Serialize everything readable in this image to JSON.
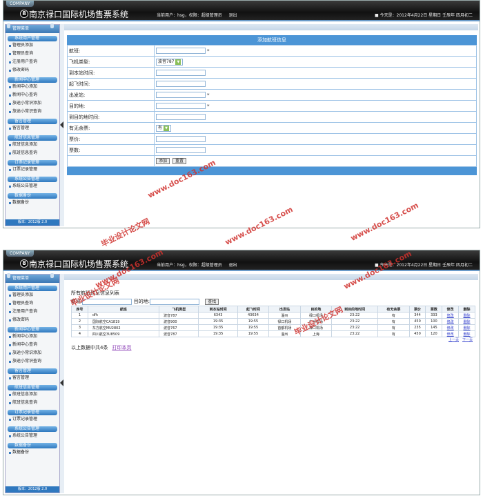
{
  "header": {
    "company": "COMPANY",
    "logo_glyph": "8",
    "site_title": "南京禄口国际机场售票系统",
    "current_user": "当前用户：hsg，权限：超级管理员",
    "logout": "退出",
    "date": "今天是：2012年4月22日 星期日 壬辰年 四月初二"
  },
  "sidebar": {
    "title": "管理菜单",
    "groups": [
      {
        "label": "系统用户管理",
        "items": [
          "管理员添加",
          "管理员查询",
          "注册用户查询",
          "修改密码"
        ]
      },
      {
        "label": "新闻中心管理",
        "items": [
          "新闻中心添加",
          "新闻中心查询",
          "旅途小常识添加",
          "旅途小常识查询"
        ]
      },
      {
        "label": "留言管理",
        "items": [
          "留言管理"
        ]
      },
      {
        "label": "航班信息管理",
        "items": [
          "航班信息添加",
          "航班信息查询"
        ]
      },
      {
        "label": "订票记录管理",
        "items": [
          "订票记录管理"
        ]
      },
      {
        "label": "系统公告管理",
        "items": [
          "系统公告管理"
        ]
      },
      {
        "label": "数据备份",
        "items": [
          "数据备份"
        ]
      }
    ],
    "version": "版本：2012版 2.0"
  },
  "form": {
    "heading": "添加航班信息",
    "fields": [
      {
        "label": "航班:",
        "type": "input",
        "required": true
      },
      {
        "label": "飞机类型:",
        "type": "select",
        "value": "波音787"
      },
      {
        "label": "到本站时间:",
        "type": "input"
      },
      {
        "label": "起飞时间:",
        "type": "input"
      },
      {
        "label": "出发站:",
        "type": "input",
        "required": true
      },
      {
        "label": "目的地:",
        "type": "input",
        "required": true
      },
      {
        "label": "到目的地时间:",
        "type": "input"
      },
      {
        "label": "有无余票:",
        "type": "select",
        "value": "有"
      },
      {
        "label": "票价:",
        "type": "input"
      },
      {
        "label": "票数:",
        "type": "input"
      }
    ],
    "required_mark": "*",
    "add_button": "添加",
    "reset_button": "重置"
  },
  "list": {
    "title": "所有航班信息信息列表",
    "search_flight_label": "航班:",
    "search_dest_label": "目的地:",
    "search_button": "查找",
    "columns": [
      "序号",
      "航班",
      "飞机类型",
      "到本站时间",
      "起飞时间",
      "出发站",
      "目的地",
      "到目的地时间",
      "有无余票",
      "票价",
      "票数",
      "修改",
      "删除"
    ],
    "rows": [
      [
        "1",
        "dfh",
        "波音787",
        "6343",
        "43634",
        "温州",
        "禄口机场",
        "23:22",
        "有",
        "344",
        "333",
        "修改",
        "删除"
      ],
      [
        "2",
        "国际航空CA1819",
        "波音900",
        "19:35",
        "19:55",
        "禄口机场",
        "广州机场",
        "23:22",
        "有",
        "450",
        "100",
        "修改",
        "删除"
      ],
      [
        "3",
        "东方航空MU2802",
        "波音767",
        "19:35",
        "19:55",
        "首都机场",
        "禄口机场",
        "23:22",
        "有",
        "235",
        "145",
        "修改",
        "删除"
      ],
      [
        "4",
        "四川航空3U8509",
        "波音787",
        "19:35",
        "19:55",
        "温州",
        "上海",
        "23:22",
        "有",
        "450",
        "120",
        "修改",
        "删除"
      ]
    ],
    "prev_page": "上一页",
    "next_page": "下一页",
    "summary": "以上数据中共4条",
    "print": "打印本页"
  },
  "watermarks": [
    "毕业设计论文网",
    "www.doc163.com"
  ]
}
